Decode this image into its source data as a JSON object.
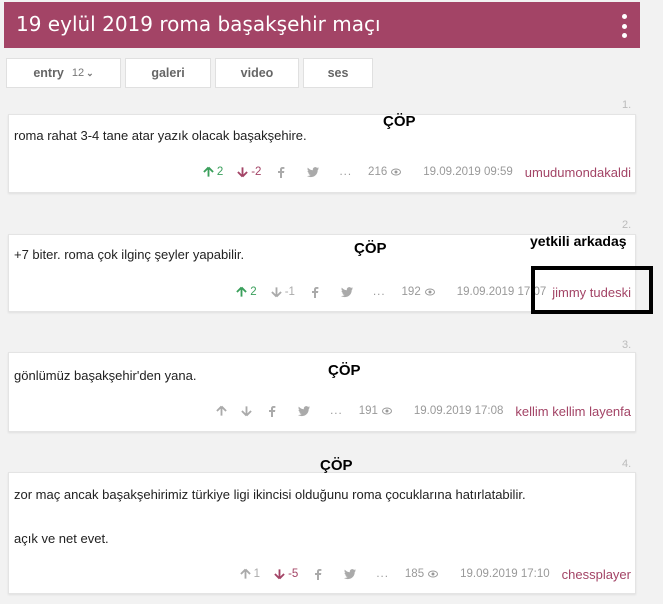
{
  "header": {
    "title": "19 eylül 2019 roma başakşehir maçı"
  },
  "tabs": {
    "entry_label": "entry",
    "entry_count": "12",
    "gallery_label": "galeri",
    "video_label": "video",
    "audio_label": "ses"
  },
  "entries": [
    {
      "number": "1.",
      "text": "roma rahat 3-4 tane atar yazık olacak başakşehire.",
      "up": "2",
      "down": "-2",
      "ellipsis": "...",
      "views": "216",
      "date": "19.09.2019 09:59",
      "author": "umudumondakaldi",
      "annotation": "ÇÖP"
    },
    {
      "number": "2.",
      "text": "+7 biter. roma çok ilginç şeyler yapabilir.",
      "up": "2",
      "down": "-1",
      "ellipsis": "...",
      "views": "192",
      "date": "19.09.2019 17:07",
      "author": "jimmy tudeski",
      "annotation": "ÇÖP",
      "extra_annotation": "yetkili arkadaş"
    },
    {
      "number": "3.",
      "text": "gönlümüz başakşehir'den yana.",
      "ellipsis": "...",
      "views": "191",
      "date": "19.09.2019 17:08",
      "author": "kellim kellim layenfa",
      "annotation": "ÇÖP"
    },
    {
      "number": "4.",
      "text": "zor maç ancak başakşehirimiz türkiye ligi ikincisi olduğunu roma çocuklarına hatırlatabilir.",
      "text2": "açık ve net evet.",
      "up": "1",
      "down": "-5",
      "ellipsis": "...",
      "views": "185",
      "date": "19.09.2019 17:10",
      "author": "chessplayer",
      "annotation": "ÇÖP"
    }
  ],
  "colors": {
    "header_bg": "#a34466",
    "upvote": "#3a9f5b",
    "downvote": "#a34466",
    "author": "#a34466"
  },
  "icons": [
    "kebab-menu-icon",
    "chevron-down-icon",
    "arrow-up-icon",
    "arrow-down-icon",
    "facebook-icon",
    "twitter-icon",
    "eye-icon"
  ]
}
